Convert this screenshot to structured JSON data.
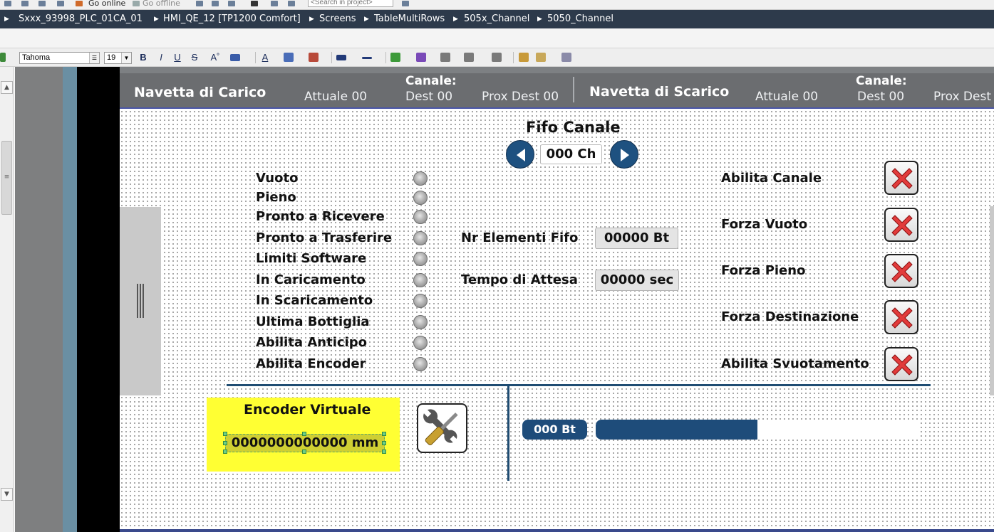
{
  "breadcrumb": [
    "Sxxx_93998_PLC_01CA_01",
    "HMI_QE_12 [TP1200 Comfort]",
    "Screens",
    "TableMultiRows",
    "505x_Channel",
    "5050_Channel"
  ],
  "top_toolbar": {
    "go_online": "Go online",
    "go_offline": "Go offline",
    "search_placeholder": "<Search in project>"
  },
  "format_toolbar": {
    "font_family": "Tahoma",
    "font_size": "19",
    "bold": "B",
    "italic": "I",
    "underline": "U",
    "strike": "S"
  },
  "header": {
    "left_title": "Navetta di Carico",
    "left_attuale": "Attuale 00",
    "left_canale": "Canale:",
    "left_dest": "Dest   00",
    "left_prox": "Prox Dest 00",
    "right_title": "Navetta di Scarico",
    "right_attuale": "Attuale 00",
    "right_canale": "Canale:",
    "right_dest": "Dest   00",
    "right_prox": "Prox Dest"
  },
  "fifo": {
    "title": "Fifo Canale",
    "channel": "000 Ch"
  },
  "status_items": [
    "Vuoto",
    "Pieno",
    "Pronto a Ricevere",
    "Pronto a Trasferire",
    "Limiti Software",
    "In Caricamento",
    "In Scaricamento",
    "Ultima Bottiglia",
    "Abilita Anticipo",
    "Abilita Encoder"
  ],
  "fields": {
    "nr_elementi_label": "Nr Elementi Fifo",
    "nr_elementi_value": "00000 Bt",
    "tempo_label": "Tempo di Attesa",
    "tempo_value": "00000 sec"
  },
  "toggles": [
    "Abilita Canale",
    "Forza Vuoto",
    "Forza Pieno",
    "Forza Destinazione",
    "Abilita Svuotamento"
  ],
  "encoder": {
    "title": "Encoder Virtuale",
    "value": "0000000000000 mm"
  },
  "counter": {
    "badge": "000 Bt",
    "fill_fraction": 0.5
  },
  "colors": {
    "accent": "#1e4c7a",
    "header_band": "#6b6d70",
    "encoder_bg": "#ffff33",
    "breadcrumb_bg": "#2d3a4b"
  }
}
